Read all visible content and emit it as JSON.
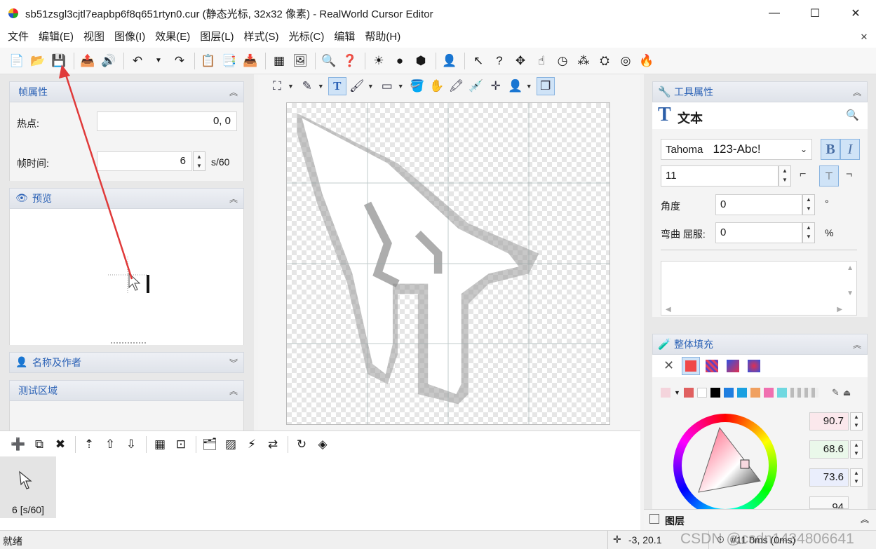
{
  "window": {
    "title": "sb51zsgl3cjtl7eapbp6f8q651rtyn0.cur (静态光标, 32x32 像素) - RealWorld Cursor Editor",
    "minimize": "—",
    "maximize": "☐",
    "close": "✕"
  },
  "menu": [
    "文件",
    "编辑(E)",
    "视图",
    "图像(I)",
    "效果(E)",
    "图层(L)",
    "样式(S)",
    "光标(C)",
    "编辑",
    "帮助(H)"
  ],
  "menu_close": "✕",
  "left_panel": {
    "frame_props": {
      "header": "帧属性",
      "hotspot_label": "热点:",
      "hotspot_value": "0, 0",
      "frame_time_label": "帧时间:",
      "frame_time_value": "6",
      "frame_time_unit": "s/60"
    },
    "preview": {
      "header": "预览"
    },
    "name_author": {
      "header": "名称及作者"
    },
    "test_area": {
      "header": "测试区域"
    }
  },
  "right_panel": {
    "tool_props": {
      "header": "工具属性",
      "tool_name": "文本",
      "font_name": "Tahoma",
      "font_sample": "123-Abc!",
      "font_size": "11",
      "angle_label": "角度",
      "angle_value": "0",
      "angle_unit": "°",
      "bend_label": "弯曲 屈服:",
      "bend_value": "0",
      "bend_unit": "%",
      "bold": "B",
      "italic": "I"
    },
    "fill": {
      "header": "整体填充",
      "values": [
        "90.7",
        "68.6",
        "73.6",
        "94"
      ],
      "swatches": [
        "#f4d4dc",
        "#e06060",
        "#ffffff",
        "#000000",
        "#1f7ee0",
        "#1aa0e0",
        "#f0a060",
        "#f070b0",
        "#70d8e0"
      ]
    },
    "layers": {
      "header": "图层"
    }
  },
  "frames": {
    "thumb_label": "6 [s/60]"
  },
  "status": {
    "left": "就绪",
    "coords": "-3, 20.1",
    "frame_info": "#11 0ms (0ms)"
  },
  "watermark": "CSDN @csdn1434806641"
}
